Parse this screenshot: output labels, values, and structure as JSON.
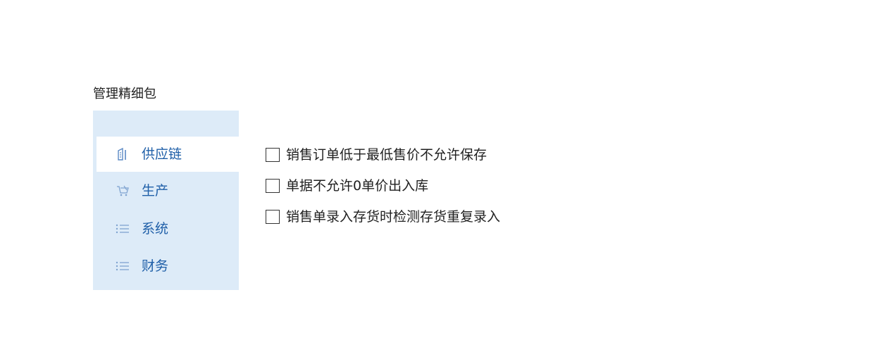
{
  "section": {
    "title": "管理精细包"
  },
  "sidebar": {
    "items": [
      {
        "label": "供应链",
        "icon": "building-icon",
        "active": true
      },
      {
        "label": "生产",
        "icon": "cart-icon",
        "active": false
      },
      {
        "label": "系统",
        "icon": "list-icon",
        "active": false
      },
      {
        "label": "财务",
        "icon": "list-icon",
        "active": false
      }
    ]
  },
  "options": [
    {
      "label": "销售订单低于最低售价不允许保存",
      "checked": false
    },
    {
      "label": "单据不允许0单价出入库",
      "checked": false
    },
    {
      "label": "销售单录入存货时检测存货重复录入",
      "checked": false
    }
  ],
  "colors": {
    "sidebar_bg": "#ddebf8",
    "active_bg": "#ffffff",
    "label_blue": "#1f5fa8",
    "icon_blue": "#5a88c4"
  }
}
